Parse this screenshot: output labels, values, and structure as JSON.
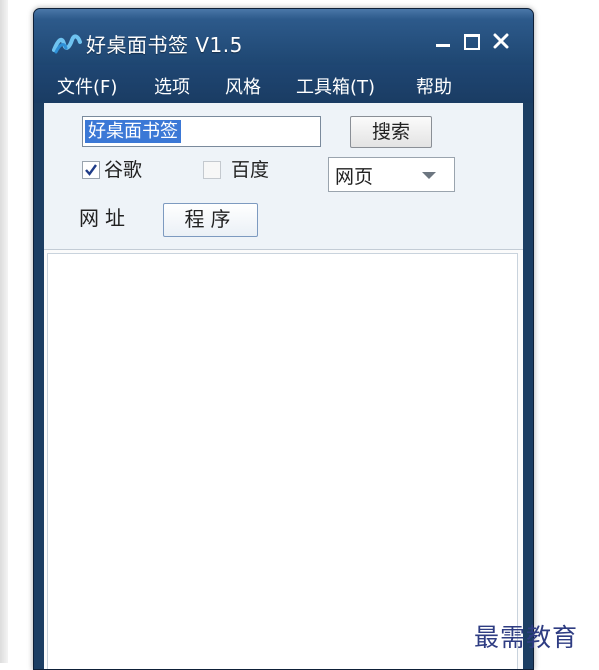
{
  "window": {
    "title": "好桌面书签 V1.5"
  },
  "menu": [
    "文件(F)",
    "选项",
    "风格",
    "工具箱(T)",
    "帮助"
  ],
  "search": {
    "value": "好桌面书签",
    "button_label": "搜索"
  },
  "engines": [
    {
      "label": "谷歌",
      "checked": true
    },
    {
      "label": "百度",
      "checked": false
    }
  ],
  "search_type": {
    "selected": "网页"
  },
  "tabs": [
    {
      "label": "网址",
      "active": false
    },
    {
      "label": "程序",
      "active": true
    }
  ],
  "watermark": "最需教育",
  "icons": {
    "app": "app-logo-icon",
    "minimize": "minimize-icon",
    "maximize": "maximize-icon",
    "close": "close-icon",
    "checkbox": "checkmark-icon",
    "dropdown": "chevron-down-icon"
  },
  "colors": {
    "titlebar": "#2d5a8b",
    "menubar": "#1f4673",
    "selection": "#3b78d6",
    "watermark": "#2e3c82"
  }
}
